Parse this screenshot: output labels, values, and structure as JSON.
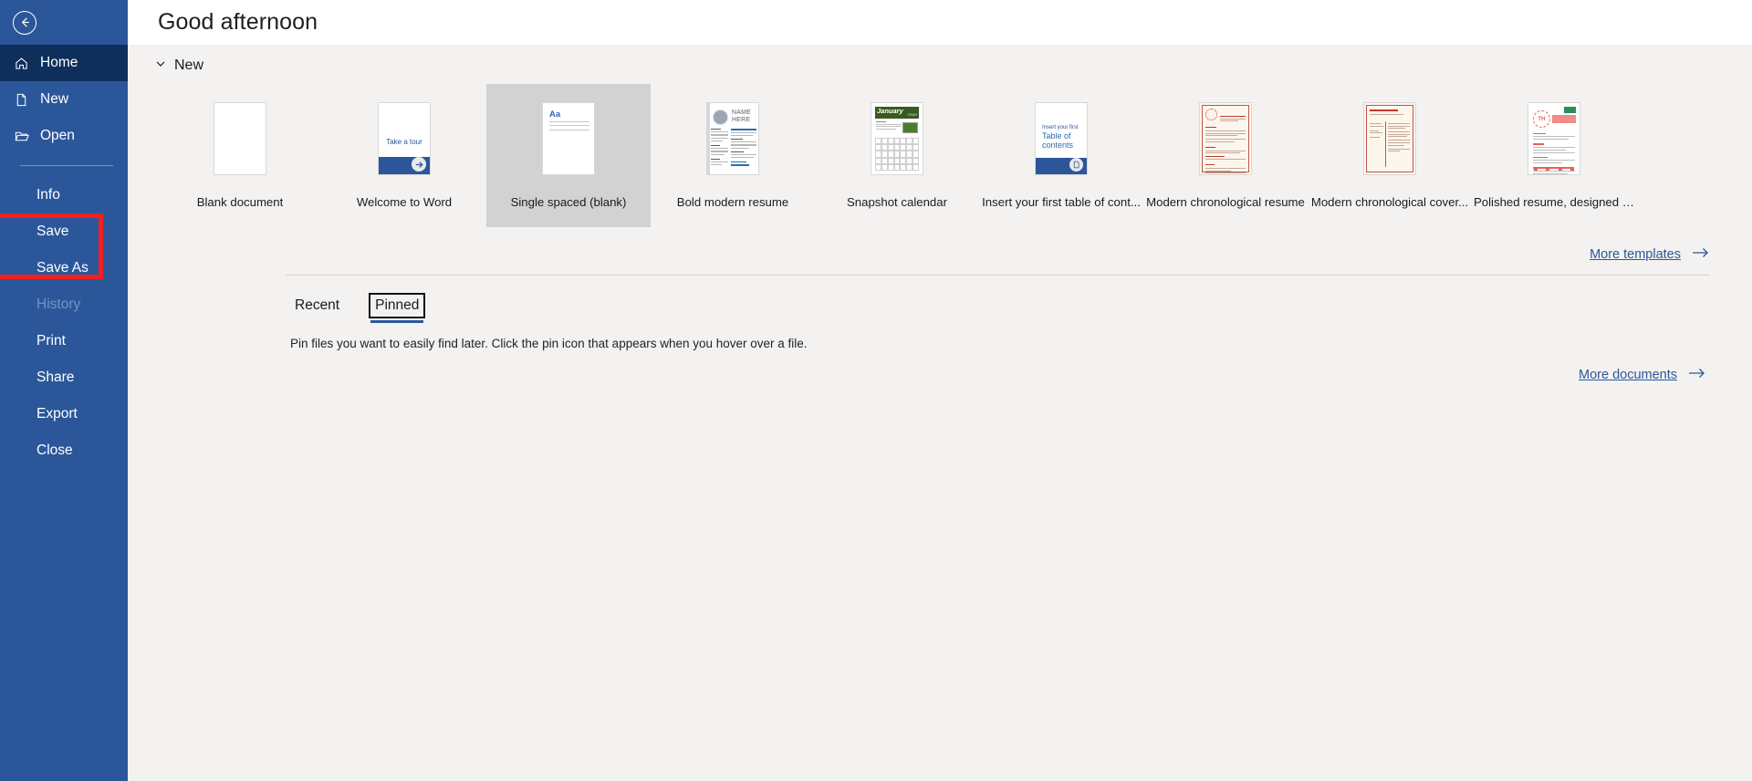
{
  "sidebar": {
    "back_label": "Back",
    "items": [
      {
        "label": "Home",
        "icon": "home-icon",
        "state": "active"
      },
      {
        "label": "New",
        "icon": "page-icon",
        "state": "normal"
      },
      {
        "label": "Open",
        "icon": "folder-icon",
        "state": "normal"
      },
      {
        "label": "Info",
        "icon": "",
        "state": "normal"
      },
      {
        "label": "Save",
        "icon": "",
        "state": "normal"
      },
      {
        "label": "Save As",
        "icon": "",
        "state": "normal"
      },
      {
        "label": "History",
        "icon": "",
        "state": "disabled"
      },
      {
        "label": "Print",
        "icon": "",
        "state": "normal"
      },
      {
        "label": "Share",
        "icon": "",
        "state": "normal"
      },
      {
        "label": "Export",
        "icon": "",
        "state": "normal"
      },
      {
        "label": "Close",
        "icon": "",
        "state": "normal"
      }
    ],
    "highlight_color": "#f02020",
    "background_color": "#2b579a",
    "active_color": "#0e2f5c"
  },
  "header": {
    "greeting": "Good afternoon"
  },
  "new_section": {
    "title": "New",
    "more_templates_label": "More templates",
    "templates": [
      {
        "label": "Blank document",
        "art": "blank"
      },
      {
        "label": "Welcome to Word",
        "art": "tour",
        "inner_text": "Take a tour"
      },
      {
        "label": "Single spaced (blank)",
        "art": "single",
        "inner_text": "Aa",
        "selected": true
      },
      {
        "label": "Bold modern resume",
        "art": "bold-resume",
        "inner_text": "NAME HERE"
      },
      {
        "label": "Snapshot calendar",
        "art": "calendar",
        "inner_text": "January",
        "inner_text2": "YEAR"
      },
      {
        "label": "Insert your first table of cont...",
        "art": "toc",
        "inner_text": "Insert your first",
        "inner_text2": "Table of contents"
      },
      {
        "label": "Modern chronological resume",
        "art": "chrono"
      },
      {
        "label": "Modern chronological cover...",
        "art": "cover"
      },
      {
        "label": "Polished resume, designed b...",
        "art": "polished",
        "inner_text": "TH"
      }
    ]
  },
  "documents_section": {
    "tabs": [
      {
        "label": "Recent",
        "selected": false
      },
      {
        "label": "Pinned",
        "selected": true
      }
    ],
    "empty_hint": "Pin files you want to easily find later. Click the pin icon that appears when you hover over a file.",
    "more_documents_label": "More documents"
  }
}
